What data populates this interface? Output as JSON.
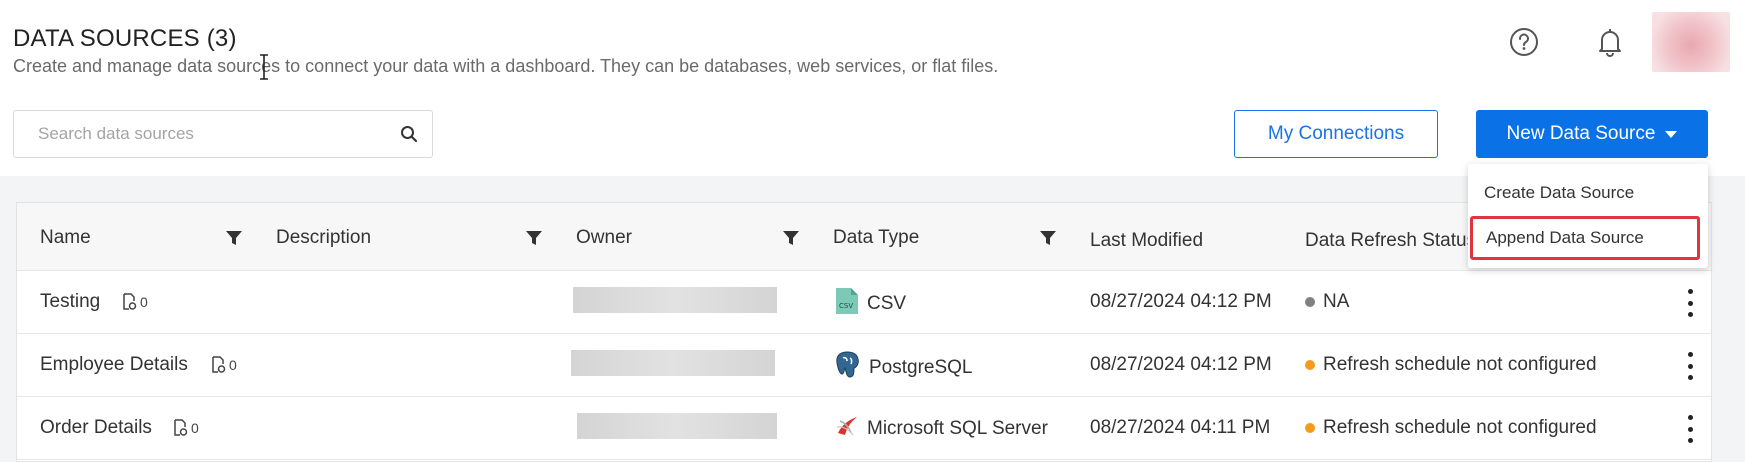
{
  "header": {
    "title": "DATA SOURCES (3)",
    "subtitle": "Create and manage data sources to connect your data with a dashboard. They can be databases, web services, or flat files."
  },
  "search": {
    "placeholder": "Search data sources",
    "value": ""
  },
  "buttons": {
    "my_connections": "My Connections",
    "new_data_source": "New Data Source"
  },
  "dropdown": {
    "items": [
      "Create Data Source",
      "Append Data Source"
    ]
  },
  "table": {
    "columns": [
      "Name",
      "Description",
      "Owner",
      "Data Type",
      "Last Modified",
      "Data Refresh Status"
    ],
    "rows": [
      {
        "name": "Testing",
        "linked_count": "0",
        "description": "",
        "data_type": "CSV",
        "data_type_icon": "csv-file-icon",
        "last_modified": "08/27/2024 04:12 PM",
        "status": "NA",
        "status_color": "#808080"
      },
      {
        "name": "Employee Details",
        "linked_count": "0",
        "description": "",
        "data_type": "PostgreSQL",
        "data_type_icon": "postgresql-icon",
        "last_modified": "08/27/2024 04:12 PM",
        "status": "Refresh schedule not configured",
        "status_color": "#f59a1b"
      },
      {
        "name": "Order Details",
        "linked_count": "0",
        "description": "",
        "data_type": "Microsoft SQL Server",
        "data_type_icon": "sql-server-icon",
        "last_modified": "08/27/2024 04:11 PM",
        "status": "Refresh schedule not configured",
        "status_color": "#f59a1b"
      }
    ]
  },
  "colors": {
    "primary": "#0a72e6",
    "highlight": "#e0343e",
    "warning_dot": "#f59a1b",
    "neutral_dot": "#808080"
  }
}
